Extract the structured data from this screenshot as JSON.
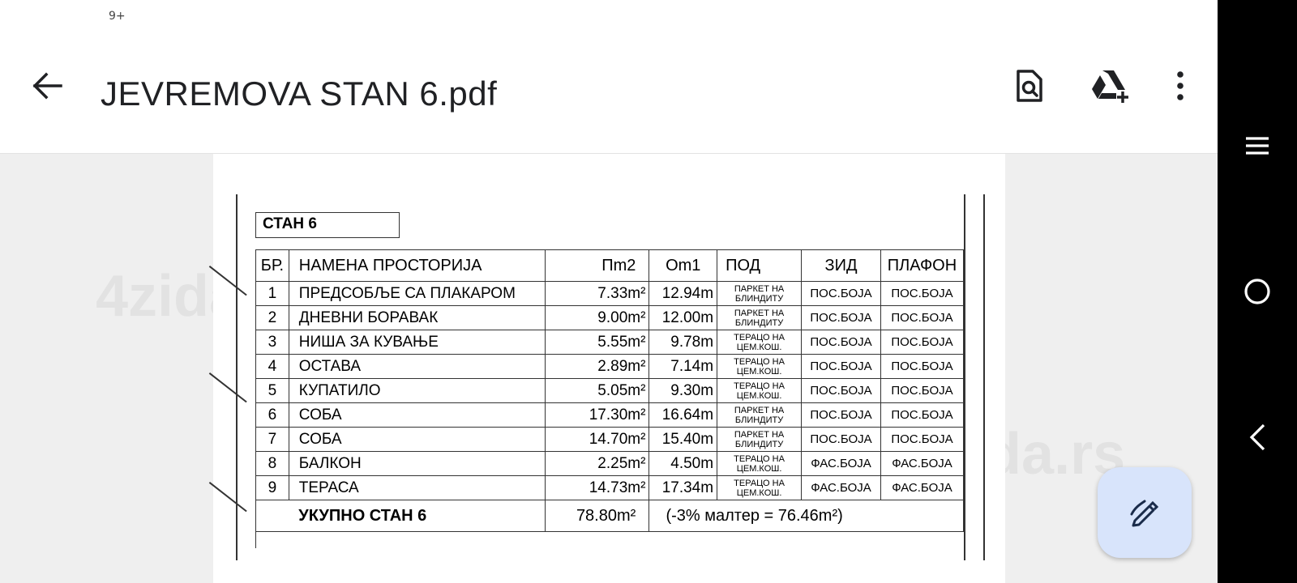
{
  "status_bar": {
    "notification_badge": "9+"
  },
  "app_bar": {
    "title": "JEVREMOVA STAN 6.pdf",
    "actions": [
      "find-in-document-icon",
      "drive-add-icon",
      "more-vert-icon"
    ]
  },
  "document": {
    "unit_title": "СТАН 6",
    "headers": {
      "no": "БР.",
      "name": "НАМЕНА ПРОСТОРИЈА",
      "area": "Пm2",
      "perimeter": "Оm1",
      "floor": "ПОД",
      "wall": "ЗИД",
      "ceiling": "ПЛАФОН"
    },
    "rows": [
      {
        "no": "1",
        "name": "ПРЕДСОБЉЕ СА ПЛАКАРОМ",
        "area": "7.33m²",
        "perimeter": "12.94m",
        "floor_1": "ПАРКЕТ НА",
        "floor_2": "БЛИНДИТУ",
        "wall": "ПОС.БОЈА",
        "ceiling": "ПОС.БОЈА"
      },
      {
        "no": "2",
        "name": "ДНЕВНИ БОРАВАК",
        "area": "9.00m²",
        "perimeter": "12.00m",
        "floor_1": "ПАРКЕТ НА",
        "floor_2": "БЛИНДИТУ",
        "wall": "ПОС.БОЈА",
        "ceiling": "ПОС.БОЈА"
      },
      {
        "no": "3",
        "name": "НИША ЗА КУВАЊЕ",
        "area": "5.55m²",
        "perimeter": "9.78m",
        "floor_1": "ТЕРАЦО НА",
        "floor_2": "ЦЕМ.КОШ.",
        "wall": "ПОС.БОЈА",
        "ceiling": "ПОС.БОЈА"
      },
      {
        "no": "4",
        "name": "ОСТАВА",
        "area": "2.89m²",
        "perimeter": "7.14m",
        "floor_1": "ТЕРАЦО НА",
        "floor_2": "ЦЕМ.КОШ.",
        "wall": "ПОС.БОЈА",
        "ceiling": "ПОС.БОЈА"
      },
      {
        "no": "5",
        "name": "КУПАТИЛО",
        "area": "5.05m²",
        "perimeter": "9.30m",
        "floor_1": "ТЕРАЦО НА",
        "floor_2": "ЦЕМ.КОШ.",
        "wall": "ПОС.БОЈА",
        "ceiling": "ПОС.БОЈА"
      },
      {
        "no": "6",
        "name": "СОБА",
        "area": "17.30m²",
        "perimeter": "16.64m",
        "floor_1": "ПАРКЕТ НА",
        "floor_2": "БЛИНДИТУ",
        "wall": "ПОС.БОЈА",
        "ceiling": "ПОС.БОЈА"
      },
      {
        "no": "7",
        "name": "СОБА",
        "area": "14.70m²",
        "perimeter": "15.40m",
        "floor_1": "ПАРКЕТ НА",
        "floor_2": "БЛИНДИТУ",
        "wall": "ПОС.БОЈА",
        "ceiling": "ПОС.БОЈА"
      },
      {
        "no": "8",
        "name": "БАЛКОН",
        "area": "2.25m²",
        "perimeter": "4.50m",
        "floor_1": "ТЕРАЦО НА",
        "floor_2": "ЦЕМ.КОШ.",
        "wall": "ФАС.БОЈА",
        "ceiling": "ФАС.БОЈА"
      },
      {
        "no": "9",
        "name": "ТЕРАСА",
        "area": "14.73m²",
        "perimeter": "17.34m",
        "floor_1": "ТЕРАЦО НА",
        "floor_2": "ЦЕМ.КОШ.",
        "wall": "ФАС.БОЈА",
        "ceiling": "ФАС.БОЈА"
      }
    ],
    "total": {
      "label": "УКУПНО СТАН 6",
      "area": "78.80m²",
      "note": "(-3% малтер = 76.46m²)"
    },
    "watermarks": [
      "4zida.rs",
      "4zida.rs"
    ]
  },
  "fab": {
    "icon": "edit-pen-icon"
  },
  "nav_bar": {
    "buttons": [
      "menu-icon",
      "home-icon",
      "back-icon"
    ]
  },
  "colors": {
    "fab_bg": "#d8e4fb",
    "app_bar_bg": "#ffffff",
    "viewer_bg": "#efefef",
    "nav_bg": "#000000"
  }
}
